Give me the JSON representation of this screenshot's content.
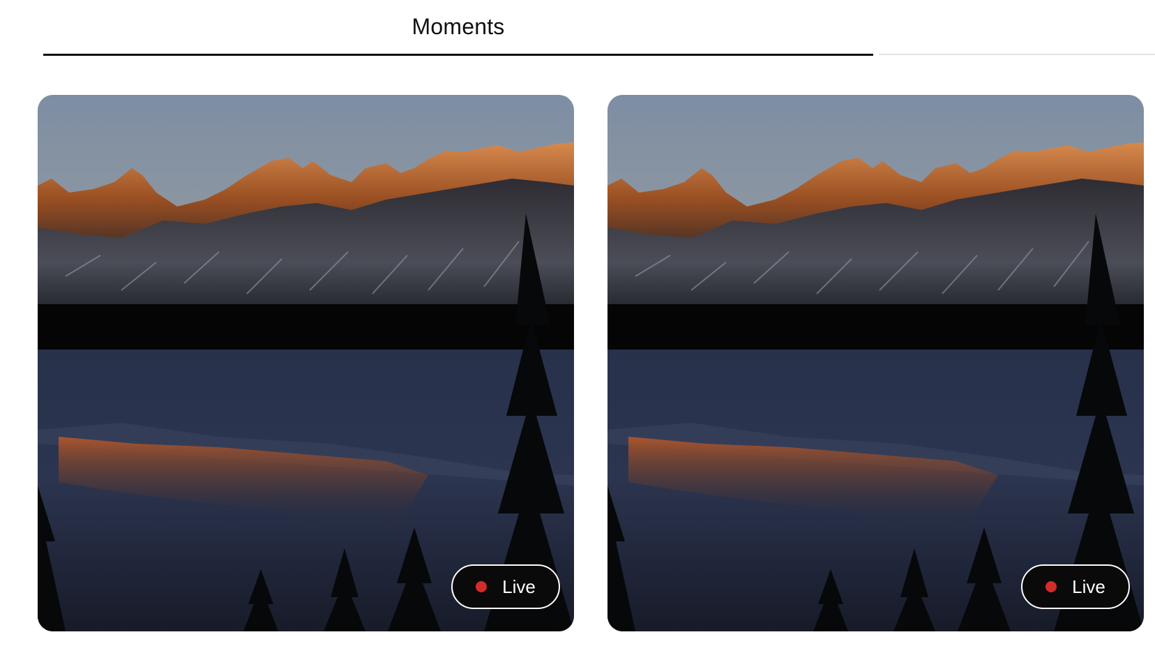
{
  "tabs": [
    {
      "label": "Moments",
      "active": true
    },
    {
      "label": "",
      "active": false
    }
  ],
  "cards": [
    {
      "badge_label": "Live",
      "badge_dot_color": "#d42b2b",
      "icon": "landscape-photo"
    },
    {
      "badge_label": "Live",
      "badge_dot_color": "#d42b2b",
      "icon": "landscape-photo"
    }
  ],
  "colors": {
    "tab_underline": "#111111",
    "badge_background": "#0a0a0a",
    "badge_border": "#ffffff"
  }
}
